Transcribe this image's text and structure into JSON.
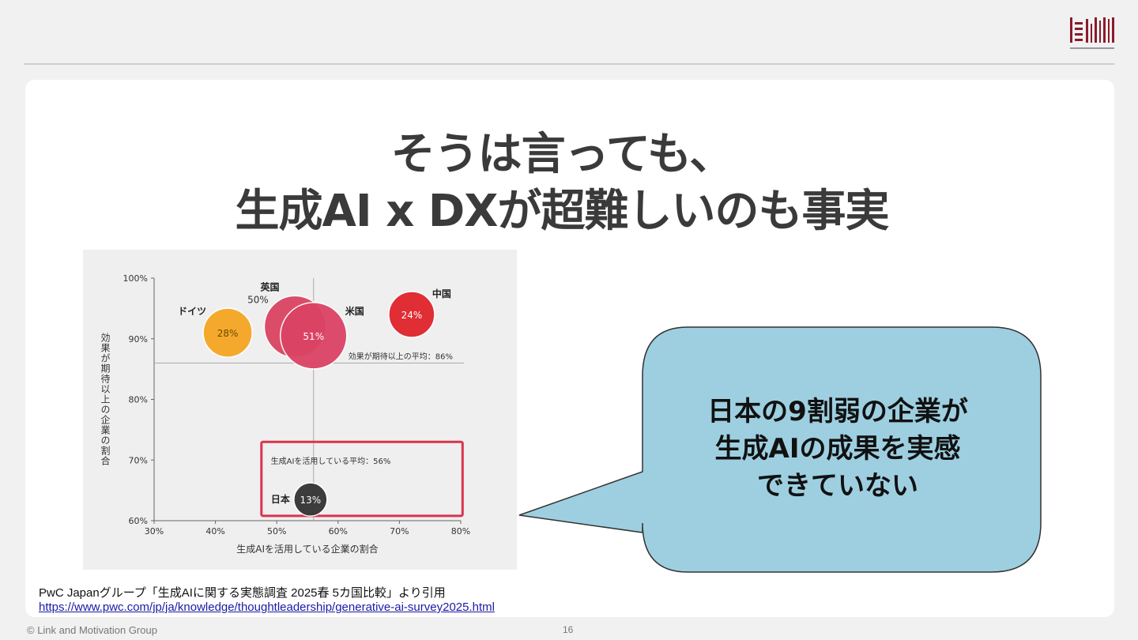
{
  "slide": {
    "title_line1": "そうは言っても、",
    "title_line2": "生成AI x DXが超難しいのも事実",
    "callout": {
      "line1": "日本の9割弱の企業が",
      "line2": "生成AIの成果を実感",
      "line3": "できていない",
      "fill": "#9dcfe0"
    },
    "source_text": "PwC Japanグループ「生成AIに関する実態調査 2025春 5カ国比較」より引用",
    "source_url": "https://www.pwc.com/jp/ja/knowledge/thoughtleadership/generative-ai-survey2025.html",
    "copyright": "© Link and Motivation Group",
    "page_number": "16"
  },
  "chart_data": {
    "type": "scatter",
    "xlabel": "生成AIを活用している企業の割合",
    "ylabel": "効果が期待以上の企業の割合",
    "xlim": [
      30,
      80
    ],
    "ylim": [
      60,
      100
    ],
    "xticks": [
      "30%",
      "40%",
      "50%",
      "60%",
      "70%",
      "80%"
    ],
    "yticks": [
      "60%",
      "70%",
      "80%",
      "90%",
      "100%"
    ],
    "avg_x": {
      "value": 56,
      "label": "生成AIを活用している平均：56%"
    },
    "avg_y": {
      "value": 86,
      "label": "効果が期待以上の平均：86%"
    },
    "points": [
      {
        "name": "ドイツ",
        "x": 42,
        "y": 91,
        "label": "28%",
        "color": "#f5a623"
      },
      {
        "name": "英国",
        "x": 53,
        "y": 92,
        "label": "50%",
        "color": "#d94460"
      },
      {
        "name": "米国",
        "x": 56,
        "y": 90.5,
        "label": "51%",
        "color": "#dc4364"
      },
      {
        "name": "中国",
        "x": 72,
        "y": 94,
        "label": "24%",
        "color": "#e0242b"
      },
      {
        "name": "日本",
        "x": 55.5,
        "y": 63.5,
        "label": "13%",
        "color": "#333333"
      }
    ],
    "highlight_color": "#d9344f"
  }
}
